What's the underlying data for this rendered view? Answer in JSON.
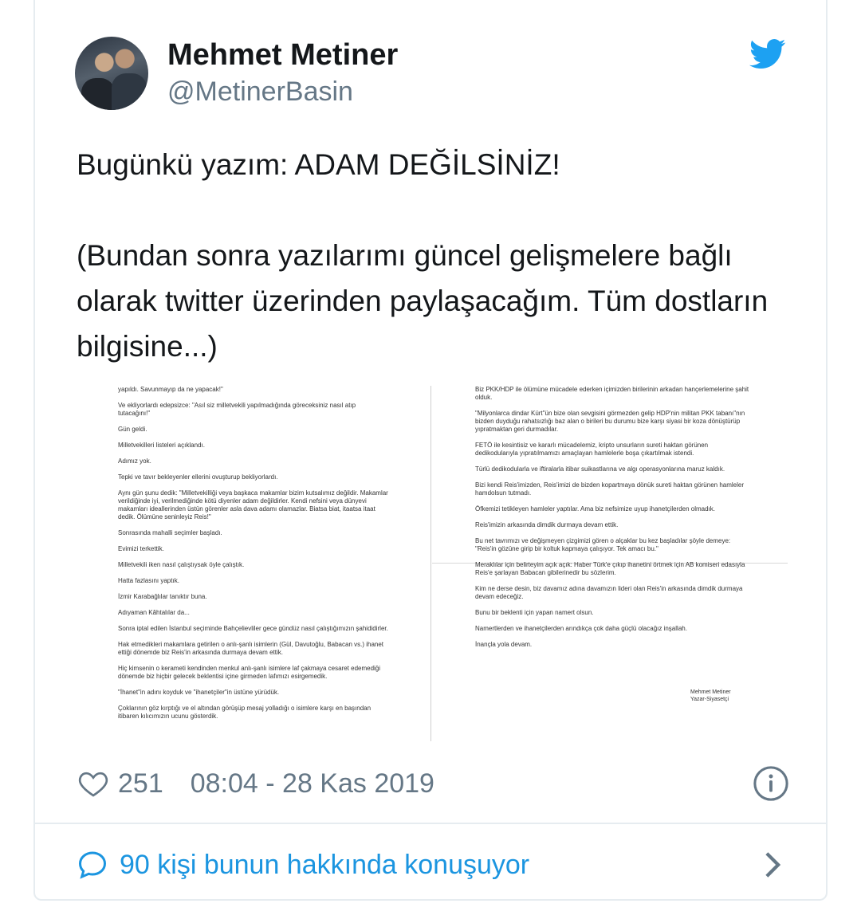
{
  "user": {
    "name": "Mehmet Metiner",
    "handle": "@MetinerBasin"
  },
  "tweet": {
    "text": "Bugünkü yazım: ADAM DEĞİLSİNİZ!\n\n(Bundan sonra yazılarımı güncel gelişmelere bağlı olarak twitter üzerinden paylaşacağım. Tüm dostların bilgisine...)"
  },
  "attachment": {
    "left_paragraphs": [
      "yapıldı. Savunmayıp da ne yapacak!\"",
      "Ve ekliyorlardı edepsizce: \"Asıl siz milletvekili yapılmadığında göreceksiniz nasıl atıp tutacağını!\"",
      "Gün geldi.",
      "Milletvekilleri listeleri açıklandı.",
      "Adımız yok.",
      "Tepki ve tavır bekleyenler ellerini ovuşturup bekliyorlardı.",
      "Aynı gün şunu dedik: \"Milletvekilliği veya başkaca makamlar bizim kutsalımız değildir. Makamlar verildiğinde iyi, verilmediğinde kötü diyenler adam değildirler. Kendi nefsini veya dünyevi makamları ideallerinden üstün görenler asla dava adamı olamazlar. Biatsa biat, itaatsa itaat dedik. Ölümüne seninleyiz Reis!\"",
      "Sonrasında mahalli seçimler başladı.",
      "Evimizi terkettik.",
      "Milletvekili iken nasıl çalıştıysak öyle çalıştık.",
      "Hatta fazlasını yaptık.",
      "İzmir Karabağlılar tanıktır buna.",
      "Adıyaman Kâhtalılar da...",
      "Sonra iptal edilen İstanbul seçiminde Bahçelievliler gece gündüz nasıl çalıştığımızın şahididirler.",
      "Hak etmedikleri makamlara getirilen o anlı-şanlı isimlerin (Gül, Davutoğlu, Babacan vs.) ihanet ettiği dönemde biz Reis'in arkasında durmaya devam ettik.",
      "Hiç kimsenin o kerameti kendinden menkul anlı-şanlı isimlere laf çakmaya cesaret edemediği dönemde biz hiçbir gelecek beklentisi içine girmeden lafımızı esirgemedik.",
      "\"İhanet\"in adını koyduk ve \"ihanetçiler\"in üstüne yürüdük.",
      "Çoklarının göz kırptığı ve el altından görüşüp mesaj yolladığı o isimlere karşı en başından itibaren kılıcımızın ucunu gösterdik."
    ],
    "right_paragraphs": [
      "Biz PKK/HDP ile ölümüne mücadele ederken içimizden birilerinin arkadan hançerlemelerine şahit olduk.",
      "\"Milyonlarca dindar Kürt\"ün bize olan sevgisini görmezden gelip HDP'nin militan PKK tabanı\"nın bizden duyduğu rahatsızlığı baz alan o birileri bu durumu bize karşı siyasi bir koza dönüştürüp yıpratmaktan geri durmadılar.",
      "FETÖ ile kesintisiz ve kararlı mücadelemiz, kripto unsurların sureti haktan görünen dedikodularıyla yıpratılmamızı amaçlayan hamlelerle boşa çıkartılmak istendi.",
      "Türlü dedikodularla ve iftiralarla itibar suikastlarına ve algı operasyonlarına maruz kaldık.",
      "Bizi kendi Reis'imizden, Reis'imizi de bizden kopartmaya dönük sureti haktan görünen hamleler hamdolsun tutmadı.",
      "Öfkemizi tetikleyen hamleler yaptılar. Ama biz nefsimize uyup ihanetçilerden olmadık.",
      "Reis'imizin arkasında dimdik durmaya devam ettik.",
      "Bu net tavrımızı ve değişmeyen çizgimizi gören o alçaklar bu kez başladılar şöyle demeye: \"Reis'in gözüne girip bir koltuk kapmaya çalışıyor. Tek amacı bu.\"",
      "Meraklılar için belirteyim açık açık: Haber Türk'e çıkıp ihanetini örtmek için AB komiseri edasıyla Reis'e şarlayan Babacan gibilerinedir bu sözlerim.",
      "Kim ne derse desin, biz davamız adına davamızın lideri olan Reis'in arkasında dimdik durmaya devam edeceğiz.",
      "Bunu bir beklenti için yapan namert olsun.",
      "Namertlerden ve ihanetçilerden arındıkça çok daha güçlü olacağız inşallah.",
      "İnançla yola devam."
    ],
    "signature_name": "Mehmet Metiner",
    "signature_title": "Yazar-Siyasetçi"
  },
  "footer": {
    "likes": "251",
    "timestamp": "08:04 - 28 Kas 2019",
    "conversation": "90 kişi bunun hakkında konuşuyor"
  },
  "icons": {
    "bird": "twitter-bird-icon",
    "heart": "heart-icon",
    "info": "info-icon",
    "bubble": "chat-bubble-icon",
    "chevron": "chevron-right-icon"
  },
  "colors": {
    "twitter_blue": "#1da1f2",
    "link_blue": "#1b95e0",
    "muted": "#657786"
  }
}
